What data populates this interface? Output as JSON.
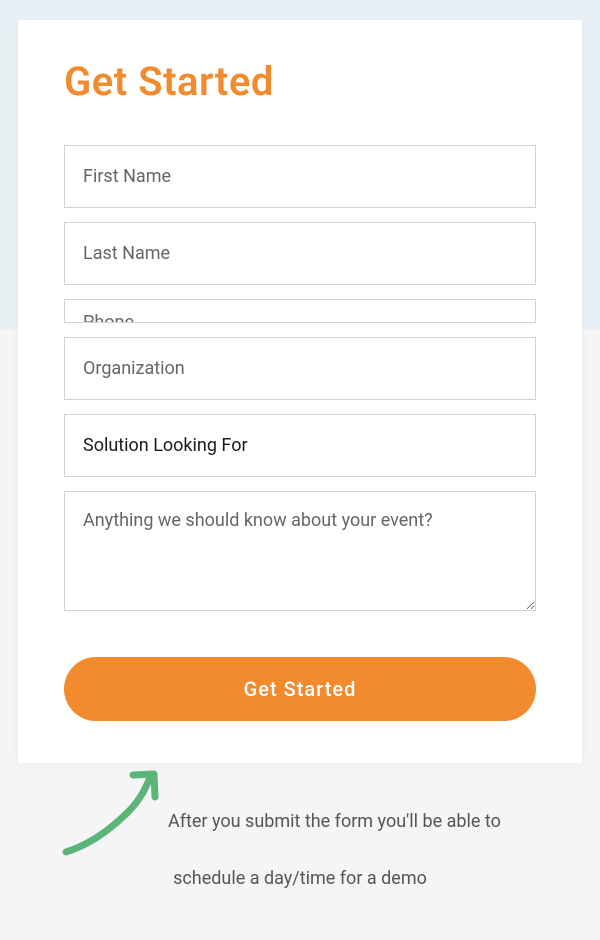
{
  "heading": "Get Started",
  "form": {
    "first_name": {
      "placeholder": "First Name",
      "value": ""
    },
    "last_name": {
      "placeholder": "Last Name",
      "value": ""
    },
    "phone": {
      "placeholder": "Phone",
      "value": ""
    },
    "organization": {
      "placeholder": "Organization",
      "value": ""
    },
    "solution": {
      "label": "Solution Looking For"
    },
    "notes": {
      "placeholder": "Anything we should know about your event?",
      "value": ""
    },
    "submit_label": "Get Started"
  },
  "footer": {
    "line1": "After you submit the form you'll be able to",
    "line2": "schedule a day/time for a demo"
  },
  "colors": {
    "accent": "#f28a2e",
    "arrow": "#5cb578"
  }
}
